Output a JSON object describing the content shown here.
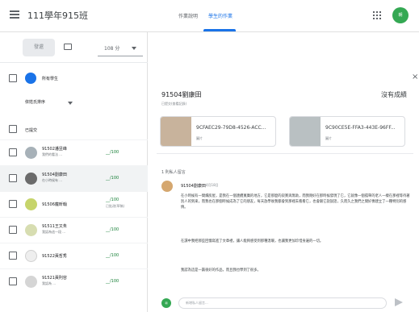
{
  "header": {
    "title": "111學年915班",
    "tabs": [
      "作業說明",
      "學生的作業"
    ],
    "avatar": "朝"
  },
  "sidebar": {
    "return_button": "發還",
    "filter": "108 分",
    "all_students": "所有學生",
    "sort": "依姓氏排序",
    "submitted": "已提交",
    "students": [
      {
        "name": "91502潘昱峰",
        "text": "我們的看法 ...",
        "score": "__/100"
      },
      {
        "name": "91504劉康田",
        "text": "在小時候有 ...",
        "score": "__/100"
      },
      {
        "name": "91506龐昕翰",
        "text": "",
        "score": "__/100",
        "score_note": "已批改(草稿)"
      },
      {
        "name": "91511王又朱",
        "text": "我認為這一段 ...",
        "score": "__/100"
      },
      {
        "name": "91522黃哲秀",
        "text": "",
        "score": "__/100"
      },
      {
        "name": "91521黃則容",
        "text": "我認為 ...",
        "score": "__/100"
      }
    ]
  },
  "details": {
    "student_name": "91504劉康田",
    "description": "已提交(查看記錄)",
    "status": "沒有成績",
    "files": [
      {
        "name": "9CFAEC29-79D8-4526-ACC...",
        "type": "圖片"
      },
      {
        "name": "9C90CE5E-FFA3-443E-96FF...",
        "type": "圖片"
      }
    ],
    "comments_label": "1 則私人留言",
    "comment_author": "91504劉康田",
    "comment_date": "4月18日",
    "paragraphs": [
      "在小時候有一間爛房屋，是我在一個連續寬廣的地方，它是那麼的寂寞與無助，而我剛好在那時候發現了它，它就像一個孤單的老人一樣在那裡等待著別人的到來，而我也在那個時候成為了它的朋友，每天放學後我都會到那裡去看看它，也會跟它說說話，久而久之我們之間好像建立了一種特別的感情。",
      "在讀中我把那些回憶寫進了文章裡，讓人能夠感受到那種溫暖，也讓我更加珍惜身邊的一切。",
      "我認為這是一篇很好的作品，而且我也學到了很多。"
    ],
    "composer_placeholder": "新增私人留言...",
    "mini_avatar": "朝"
  }
}
